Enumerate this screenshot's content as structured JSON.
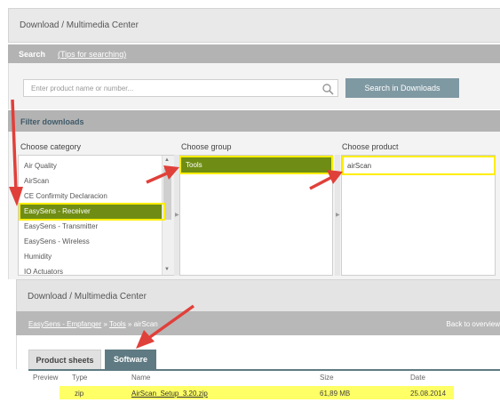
{
  "header": {
    "title": "Download / Multimedia Center"
  },
  "search": {
    "label": "Search",
    "tips_link": "(Tips for searching)",
    "placeholder": "Enter product name or number...",
    "button_label": "Search in Downloads"
  },
  "filter": {
    "title": "Filter downloads",
    "category": {
      "heading": "Choose category",
      "items": [
        "Air Quality",
        "AirScan",
        "CE Confirmity Declaracion",
        "EasySens - Receiver",
        "EasySens - Transmitter",
        "EasySens - Wireless",
        "Humidity",
        "IO Actuators"
      ],
      "selected": "EasySens - Receiver"
    },
    "group": {
      "heading": "Choose group",
      "items": [
        "Tools"
      ],
      "selected": "Tools"
    },
    "product": {
      "heading": "Choose product",
      "items": [
        "airScan"
      ],
      "selected": "airScan"
    }
  },
  "detail": {
    "title": "Download / Multimedia Center",
    "breadcrumb": {
      "part1": "EasySens - Empfanger",
      "sep": " » ",
      "part2": "Tools",
      "part3": "airScan"
    },
    "back_link": "Back to overview",
    "tabs": [
      {
        "label": "Product sheets",
        "active": false
      },
      {
        "label": "Software",
        "active": true
      }
    ],
    "table": {
      "columns": [
        "Preview",
        "Type",
        "Name",
        "Size",
        "Date"
      ],
      "rows": [
        {
          "type": "zip",
          "name": "AirScan_Setup_3.20.zip",
          "size": "61,89 MB",
          "date": "25.08.2014"
        }
      ]
    }
  },
  "colors": {
    "selection_green": "#6f8d14",
    "highlight_yellow": "#ffee00",
    "annotation_red": "#e0403a",
    "tab_active": "#5f7a82"
  }
}
